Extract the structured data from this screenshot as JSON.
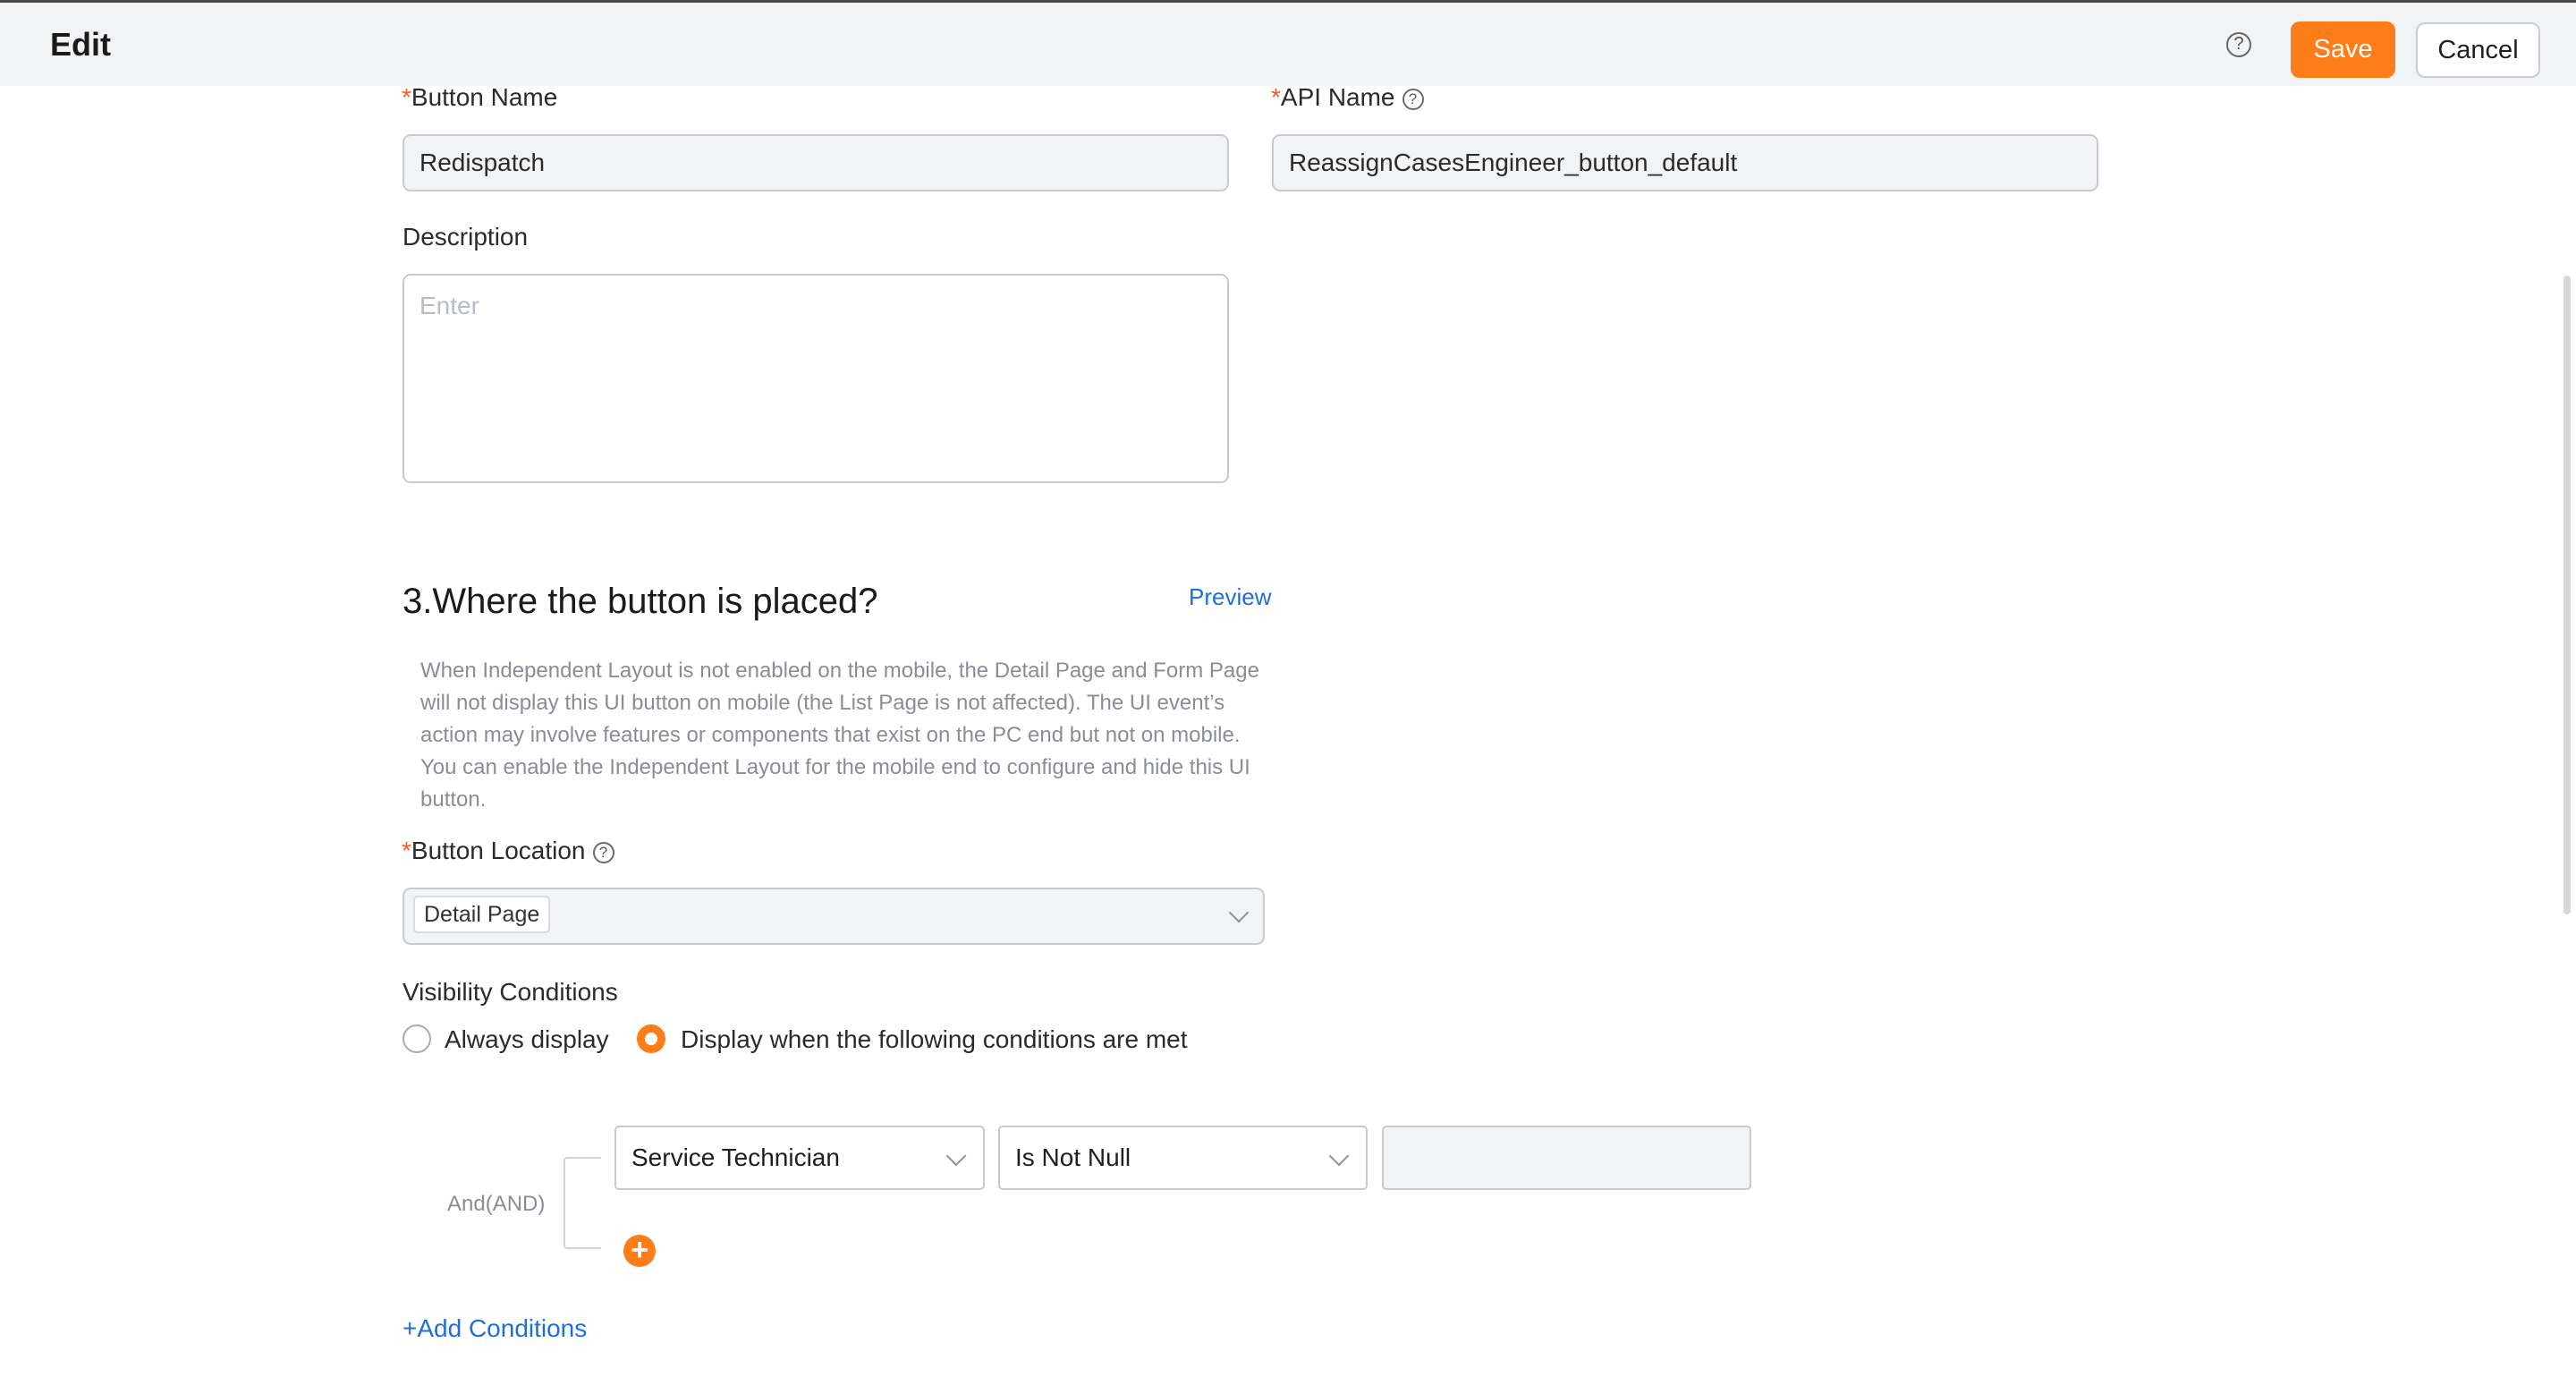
{
  "header": {
    "title": "Edit",
    "save_label": "Save",
    "cancel_label": "Cancel",
    "help_glyph": "?"
  },
  "form": {
    "button_name": {
      "required_mark": "*",
      "label": "Button Name",
      "value": "Redispatch"
    },
    "api_name": {
      "required_mark": "*",
      "label": "API Name",
      "value": "ReassignCasesEngineer_button_default"
    },
    "description": {
      "label": "Description",
      "placeholder": "Enter"
    }
  },
  "placement": {
    "title": "3.Where the button is placed?",
    "preview_label": "Preview",
    "hint_lines": [
      "When Independent Layout is not enabled on the mobile, the Detail Page and Form Page",
      "will not display this UI button on mobile (the List Page is not affected). The UI event’s",
      "action may involve features or components that exist on the PC end but not on mobile.",
      "You can enable the Independent Layout for the mobile end to configure and hide this UI",
      "button."
    ],
    "location": {
      "required_mark": "*",
      "label": "Button Location",
      "selected_tag": "Detail Page"
    }
  },
  "visibility": {
    "label": "Visibility Conditions",
    "options": [
      {
        "label": "Always display",
        "selected": false
      },
      {
        "label": "Display when the following conditions are met",
        "selected": true
      }
    ],
    "logic_label": "And(AND)",
    "condition": {
      "field": "Service Technician",
      "operator": "Is Not Null",
      "value": ""
    },
    "add_conditions_label": "+Add Conditions"
  },
  "colors": {
    "accent": "#ff7d19",
    "link": "#1e6fd9",
    "required": "#ff5a1f"
  },
  "icons": {
    "help": "question-circle-icon",
    "dropdown": "chevron-down-icon",
    "add": "plus-circle-icon"
  }
}
